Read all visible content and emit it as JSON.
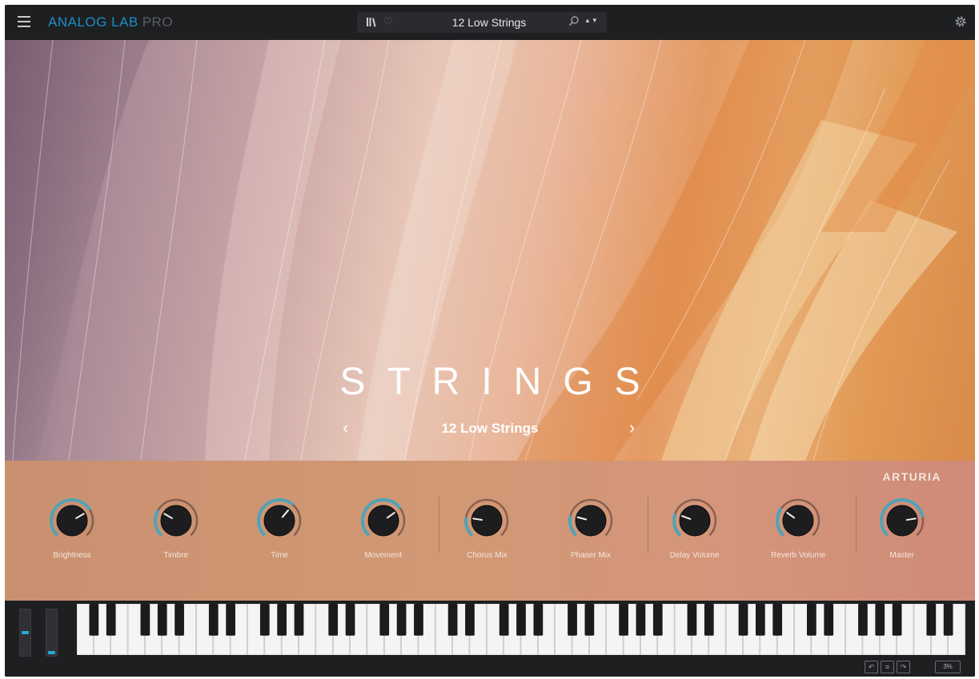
{
  "app": {
    "brand_primary": "ANALOG LAB",
    "brand_secondary": "PRO",
    "accent_color": "#1c8fc7"
  },
  "topbar": {
    "preset_name": "12 Low Strings",
    "icons": [
      "menu-icon",
      "library-icon",
      "heart-icon",
      "search-icon",
      "up-down-arrows-icon",
      "settings-icon"
    ]
  },
  "hero": {
    "instrument": "STRINGS",
    "preset_name": "12 Low Strings",
    "prev_arrow": "‹",
    "next_arrow": "›"
  },
  "panel": {
    "brand": "ARTURIA",
    "knobs": [
      {
        "label": "Brightness",
        "value": 0.72
      },
      {
        "label": "Timbre",
        "value": 0.28
      },
      {
        "label": "Time",
        "value": 0.65
      },
      {
        "label": "Movement",
        "value": 0.7
      },
      {
        "label": "Chorus Mix",
        "value": 0.2
      },
      {
        "label": "Phaser Mix",
        "value": 0.22
      },
      {
        "label": "Delay Volume",
        "value": 0.24
      },
      {
        "label": "Reverb Volume",
        "value": 0.3
      },
      {
        "label": "Master",
        "value": 0.8
      }
    ]
  },
  "keyboard": {
    "white_key_count": 52,
    "pitch_wheel_level": 0.5,
    "mod_wheel_level": 0.0
  },
  "bottombar": {
    "undo": "↶",
    "history": "≡",
    "redo": "↷",
    "zoom": "3%"
  }
}
